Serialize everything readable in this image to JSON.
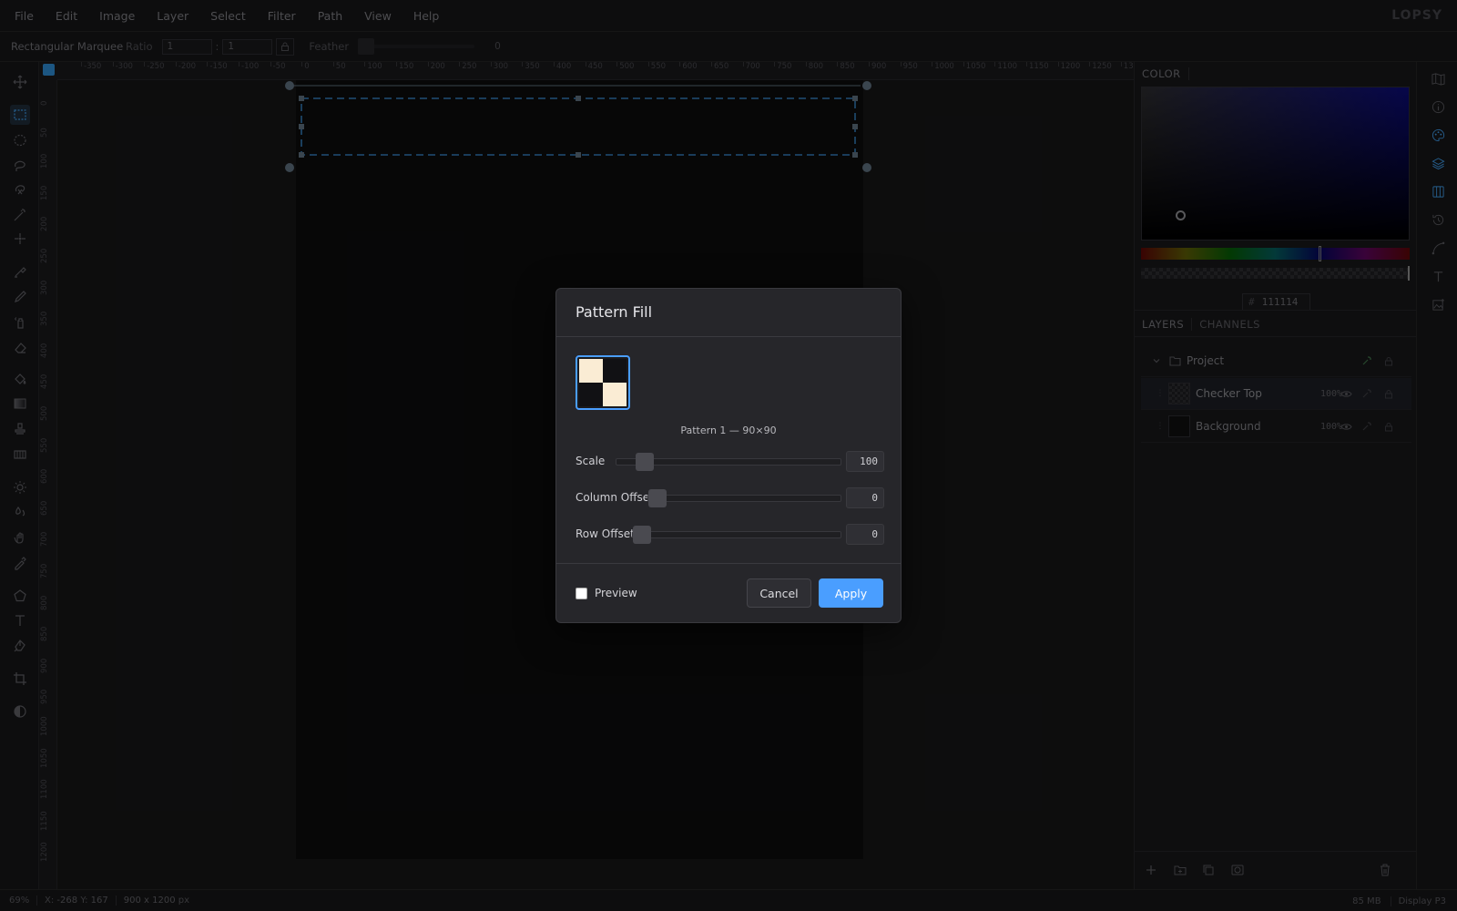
{
  "menu": [
    "File",
    "Edit",
    "Image",
    "Layer",
    "Select",
    "Filter",
    "Path",
    "View",
    "Help"
  ],
  "logo": "LOPSY",
  "options": {
    "tool_name": "Rectangular Marquee",
    "ratio_label": "Ratio",
    "ratio_a": "1",
    "ratio_sep": ":",
    "ratio_b": "1",
    "feather_label": "Feather",
    "feather_value": "0"
  },
  "ruler_h": [
    "-350",
    "-300",
    "-250",
    "-200",
    "-150",
    "-100",
    "-50",
    "0",
    "50",
    "100",
    "150",
    "200",
    "250",
    "300",
    "350",
    "400",
    "450",
    "500",
    "550",
    "600",
    "650",
    "700",
    "750",
    "800",
    "850",
    "900",
    "950",
    "1000",
    "1050",
    "1100",
    "1150",
    "1200",
    "1250",
    "13"
  ],
  "ruler_v": [
    "0",
    "50",
    "100",
    "150",
    "200",
    "250",
    "300",
    "350",
    "400",
    "450",
    "500",
    "550",
    "600",
    "650",
    "700",
    "750",
    "800",
    "850",
    "900",
    "950",
    "1000",
    "1050",
    "1100",
    "1150",
    "1200"
  ],
  "color_panel": {
    "title": "COLOR",
    "hex_prefix": "#",
    "hex": "111114"
  },
  "layers_panel": {
    "tabs": [
      "LAYERS",
      "CHANNELS"
    ],
    "group_name": "Project",
    "layers": [
      {
        "name": "Checker Top",
        "opacity": "100%"
      },
      {
        "name": "Background",
        "opacity": "100%"
      }
    ]
  },
  "status": {
    "zoom": "69%",
    "x_label": "X:",
    "x": "-268",
    "y_label": "Y:",
    "y": "167",
    "doc_size": "900 x 1200",
    "doc_unit": "px",
    "memory": "85 MB",
    "profile": "Display P3"
  },
  "dialog": {
    "title": "Pattern Fill",
    "pattern_caption": "Pattern 1 — 90×90",
    "controls": [
      {
        "label": "Scale",
        "value": "100"
      },
      {
        "label": "Column Offset",
        "value": "0"
      },
      {
        "label": "Row Offset",
        "value": "0"
      }
    ],
    "preview_label": "Preview",
    "cancel_label": "Cancel",
    "apply_label": "Apply",
    "pattern_colors": [
      "#faecd4",
      "#111114"
    ]
  },
  "colors": {
    "accent": "#4a9eff",
    "selection": "#2b84c8"
  }
}
